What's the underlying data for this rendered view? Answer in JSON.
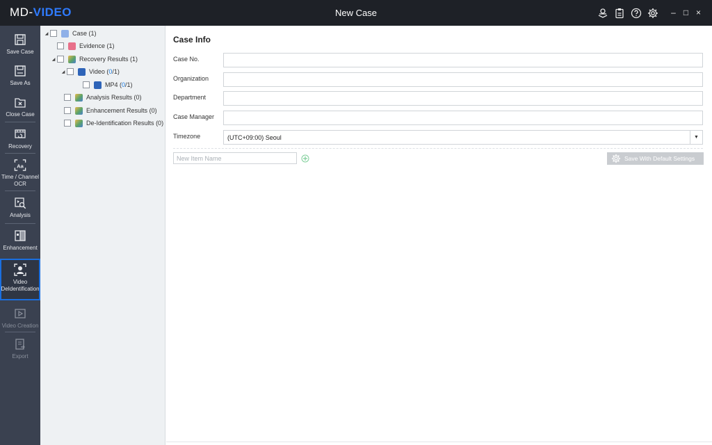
{
  "app": {
    "logo_prefix": "MD-",
    "logo_suffix": "VIDEO",
    "window_title": "New Case",
    "accent": "#2f7bff"
  },
  "titlebar": {
    "icons": [
      "upload-case-icon",
      "clipboard-icon",
      "help-icon",
      "settings-icon"
    ],
    "minimize": "–",
    "maximize": "□",
    "close": "×"
  },
  "sidenav": {
    "items": [
      {
        "label": "Save Case",
        "icon": "save-icon",
        "disabled": false,
        "active": false
      },
      {
        "label": "Save As",
        "icon": "save-as-icon",
        "disabled": false,
        "active": false
      },
      {
        "label": "Close Case",
        "icon": "close-case-icon",
        "disabled": false,
        "active": false
      },
      {
        "label": "Recovery",
        "icon": "recovery-icon",
        "disabled": false,
        "active": false
      },
      {
        "label": "Time / Channel\nOCR",
        "icon": "ocr-icon",
        "disabled": false,
        "active": false
      },
      {
        "label": "Analysis",
        "icon": "analysis-icon",
        "disabled": false,
        "active": false
      },
      {
        "label": "Enhancement",
        "icon": "enhancement-icon",
        "disabled": false,
        "active": false
      },
      {
        "label": "Video\nDeIdentification",
        "icon": "deidentification-icon",
        "disabled": false,
        "active": true
      },
      {
        "label": "Video Creation",
        "icon": "video-creation-icon",
        "disabled": true,
        "active": false
      },
      {
        "label": "Export",
        "icon": "export-icon",
        "disabled": true,
        "active": false
      }
    ]
  },
  "tree": {
    "items": [
      {
        "label": "Case",
        "count": "(1)",
        "expanded": true,
        "depth": 0,
        "icon_color": "#8fb0e8"
      },
      {
        "label": "Evidence",
        "count": "(1)",
        "depth": 1,
        "icon_color": "#e8708a"
      },
      {
        "label": "Recovery Results",
        "count": "(1)",
        "expanded": true,
        "depth": 1,
        "icon_color": "#5aa36a"
      },
      {
        "label": "Video",
        "count_open": "(",
        "count_highlight": "0",
        "count_close": "/1)",
        "expanded": true,
        "depth": 2,
        "icon_color": "#2e64b8"
      },
      {
        "label": "MP4",
        "count_open": "(",
        "count_highlight": "0",
        "count_close": "/1)",
        "depth": 3,
        "icon_color": "#2e64b8"
      },
      {
        "label": "Analysis Results",
        "count": "(0)",
        "depth": 1,
        "icon_color": "#5aa36a"
      },
      {
        "label": "Enhancement Results",
        "count": "(0)",
        "depth": 1,
        "icon_color": "#5aa36a"
      },
      {
        "label": "De-Identification Results",
        "count": "(0)",
        "depth": 1,
        "icon_color": "#5aa36a"
      }
    ]
  },
  "case_info": {
    "title": "Case Info",
    "fields": [
      {
        "label": "Case No.",
        "value": ""
      },
      {
        "label": "Organization",
        "value": ""
      },
      {
        "label": "Department",
        "value": ""
      },
      {
        "label": "Case Manager",
        "value": ""
      }
    ],
    "timezone_label": "Timezone",
    "timezone_value": "(UTC+09:00) Seoul",
    "new_item_placeholder": "New Item Name",
    "save_default_label": "Save With Default Settings"
  }
}
